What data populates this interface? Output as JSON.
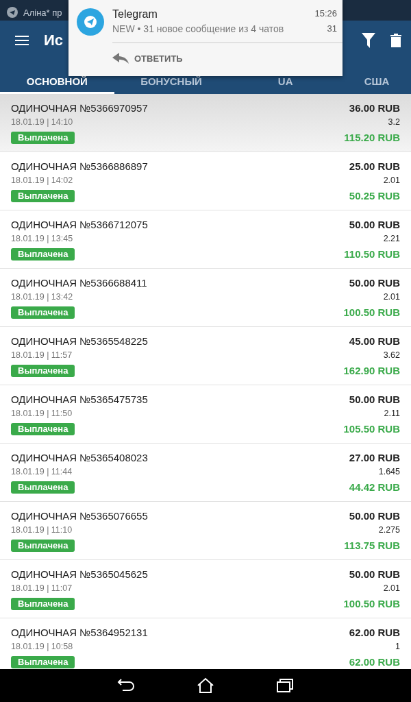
{
  "status_bar": {
    "ticker": "Аліна* пр"
  },
  "app_bar": {
    "title": "Ис"
  },
  "tabs": [
    {
      "label": "ОСНОВНОЙ",
      "selected": true
    },
    {
      "label": "БОНУСНЫЙ",
      "selected": false
    },
    {
      "label": "UA",
      "selected": false
    },
    {
      "label": "США",
      "selected": false
    }
  ],
  "notification": {
    "app": "Telegram",
    "time": "15:26",
    "text": "NEW • 31 новое сообщение из 4 чатов",
    "count": "31",
    "action": "ОТВЕТИТЬ"
  },
  "bets": [
    {
      "title": "ОДИНОЧНАЯ №5366970957",
      "date": "18.01.19 | 14:10",
      "status": "Выплачена",
      "stake": "36.00 RUB",
      "odds": "3.2",
      "payout": "115.20 RUB",
      "selected": true
    },
    {
      "title": "ОДИНОЧНАЯ №5366886897",
      "date": "18.01.19 | 14:02",
      "status": "Выплачена",
      "stake": "25.00 RUB",
      "odds": "2.01",
      "payout": "50.25 RUB",
      "selected": false
    },
    {
      "title": "ОДИНОЧНАЯ №5366712075",
      "date": "18.01.19 | 13:45",
      "status": "Выплачена",
      "stake": "50.00 RUB",
      "odds": "2.21",
      "payout": "110.50 RUB",
      "selected": false
    },
    {
      "title": "ОДИНОЧНАЯ №5366688411",
      "date": "18.01.19 | 13:42",
      "status": "Выплачена",
      "stake": "50.00 RUB",
      "odds": "2.01",
      "payout": "100.50 RUB",
      "selected": false
    },
    {
      "title": "ОДИНОЧНАЯ №5365548225",
      "date": "18.01.19 | 11:57",
      "status": "Выплачена",
      "stake": "45.00 RUB",
      "odds": "3.62",
      "payout": "162.90 RUB",
      "selected": false
    },
    {
      "title": "ОДИНОЧНАЯ №5365475735",
      "date": "18.01.19 | 11:50",
      "status": "Выплачена",
      "stake": "50.00 RUB",
      "odds": "2.11",
      "payout": "105.50 RUB",
      "selected": false
    },
    {
      "title": "ОДИНОЧНАЯ №5365408023",
      "date": "18.01.19 | 11:44",
      "status": "Выплачена",
      "stake": "27.00 RUB",
      "odds": "1.645",
      "payout": "44.42 RUB",
      "selected": false
    },
    {
      "title": "ОДИНОЧНАЯ №5365076655",
      "date": "18.01.19 | 11:10",
      "status": "Выплачена",
      "stake": "50.00 RUB",
      "odds": "2.275",
      "payout": "113.75 RUB",
      "selected": false
    },
    {
      "title": "ОДИНОЧНАЯ №5365045625",
      "date": "18.01.19 | 11:07",
      "status": "Выплачена",
      "stake": "50.00 RUB",
      "odds": "2.01",
      "payout": "100.50 RUB",
      "selected": false
    },
    {
      "title": "ОДИНОЧНАЯ №5364952131",
      "date": "18.01.19 | 10:58",
      "status": "Выплачена",
      "stake": "62.00 RUB",
      "odds": "1",
      "payout": "62.00 RUB",
      "selected": false
    }
  ]
}
